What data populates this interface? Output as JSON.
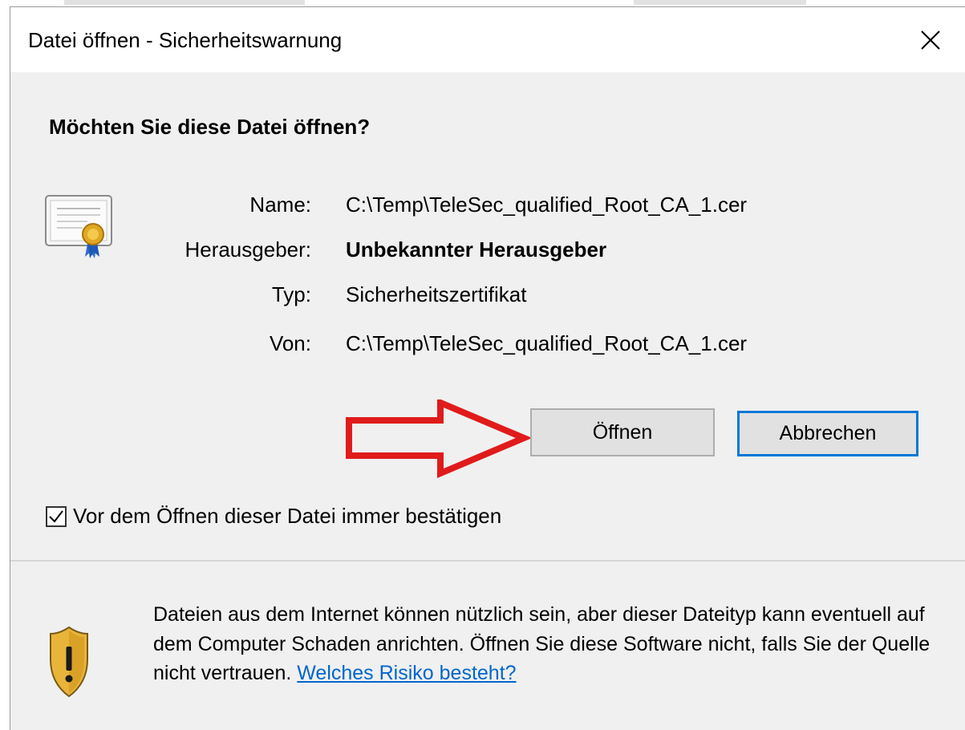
{
  "dialog": {
    "title": "Datei öffnen - Sicherheitswarnung",
    "heading": "Möchten Sie diese Datei öffnen?",
    "fields": {
      "name": {
        "label": "Name:",
        "value": "C:\\Temp\\TeleSec_qualified_Root_CA_1.cer"
      },
      "publisher": {
        "label": "Herausgeber:",
        "value": "Unbekannter Herausgeber"
      },
      "type": {
        "label": "Typ:",
        "value": "Sicherheitszertifikat"
      },
      "from": {
        "label": "Von:",
        "value": "C:\\Temp\\TeleSec_qualified_Root_CA_1.cer"
      }
    },
    "buttons": {
      "open": "Öffnen",
      "cancel": "Abbrechen"
    },
    "checkbox": {
      "label": "Vor dem Öffnen dieser Datei immer bestätigen",
      "checked": true
    },
    "warning": {
      "text": "Dateien aus dem Internet können nützlich sein, aber dieser Dateityp kann eventuell auf dem Computer Schaden anrichten. Öffnen Sie diese Software nicht, falls Sie der Quelle nicht vertrauen. ",
      "link": "Welches Risiko besteht?"
    }
  },
  "colors": {
    "accent": "#0078d7",
    "link": "#0066cc",
    "annotation_arrow": "#e01b1b",
    "dialog_bg": "#f0f0f0"
  },
  "icons": [
    "certificate-icon",
    "close-icon",
    "shield-warning-icon",
    "checkmark-icon",
    "arrow-annotation"
  ]
}
